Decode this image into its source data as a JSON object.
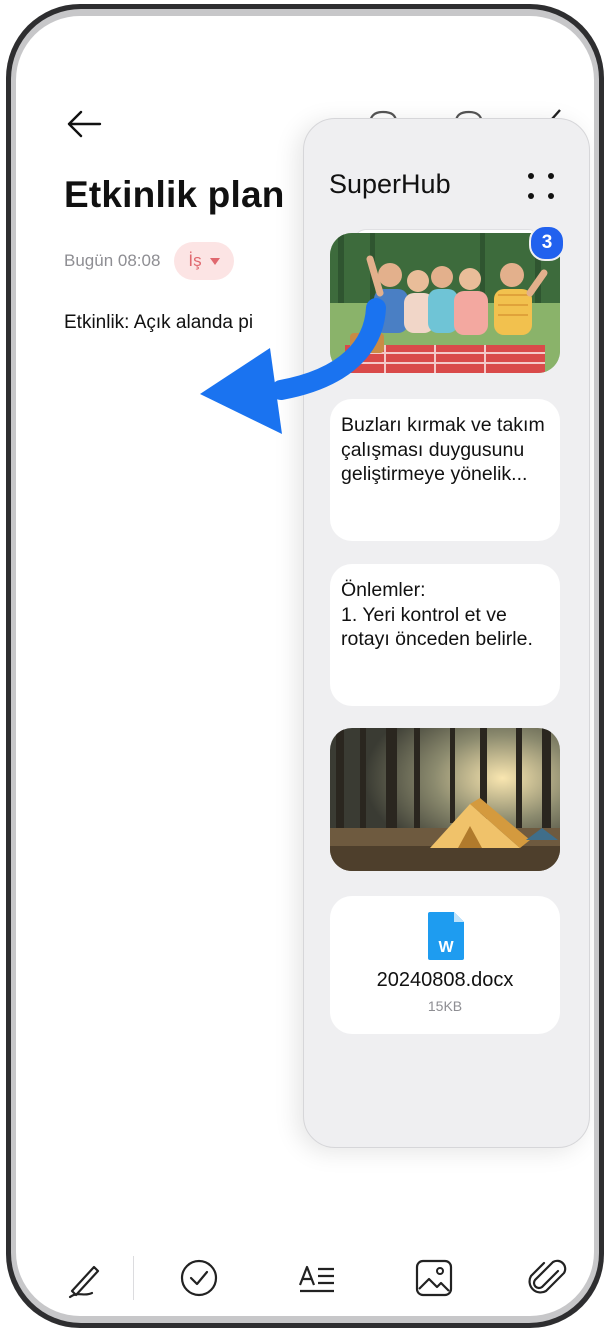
{
  "note": {
    "title": "Etkinlik plan",
    "date": "Bugün 08:08",
    "tag": "İş",
    "body": "Etkinlik: Açık alanda pi"
  },
  "superhub": {
    "title": "SuperHub",
    "badge_count": "3",
    "items": [
      {
        "type": "image",
        "icon": "group-picnic-photo"
      },
      {
        "type": "text",
        "text": "Buzları kırmak ve takım çalışması duygusunu geliştirmeye yönelik..."
      },
      {
        "type": "text",
        "text": "Önlemler:\n1. Yeri kontrol et ve rotayı önceden belirle."
      },
      {
        "type": "image",
        "icon": "camping-tent-photo"
      },
      {
        "type": "file",
        "name": "20240808.docx",
        "size": "15KB",
        "file_badge": "W"
      }
    ]
  },
  "toolbar": {
    "items": [
      "handwriting-icon",
      "checklist-icon",
      "text-format-icon",
      "image-icon",
      "attachment-icon"
    ]
  },
  "colors": {
    "accent": "#2161ee",
    "arrow": "#1a73f0",
    "tag_bg": "#fce4e4",
    "tag_text": "#e0686f",
    "panel_bg": "#efeff1"
  }
}
